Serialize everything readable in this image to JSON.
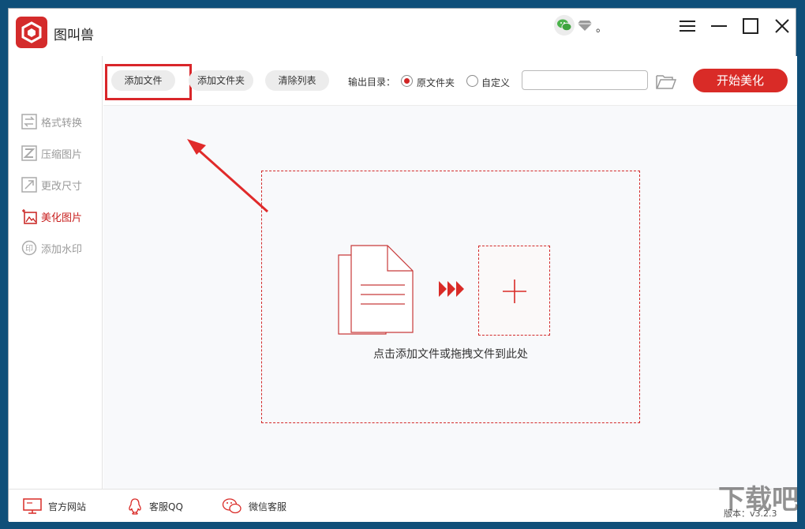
{
  "app": {
    "title": "图叫兽",
    "title_dot": "。"
  },
  "window_controls": [
    "menu-icon",
    "minimize-icon",
    "maximize-icon",
    "close-icon"
  ],
  "sidebar": {
    "items": [
      {
        "label": "格式转换",
        "icon": "format-convert-icon",
        "active": false
      },
      {
        "label": "压缩图片",
        "icon": "compress-icon",
        "active": false
      },
      {
        "label": "更改尺寸",
        "icon": "resize-icon",
        "active": false
      },
      {
        "label": "美化图片",
        "icon": "beautify-icon",
        "active": true
      },
      {
        "label": "添加水印",
        "icon": "watermark-icon",
        "active": false
      }
    ]
  },
  "toolbar": {
    "add_file_label": "添加文件",
    "add_folder_label": "添加文件夹",
    "clear_list_label": "清除列表",
    "output_label": "输出目录：",
    "option_original": "原文件夹",
    "option_custom": "自定义",
    "path_value": "",
    "start_label": "开始美化"
  },
  "content": {
    "drop_text": "点击添加文件或拖拽文件到此处"
  },
  "statusbar": {
    "website_label": "官方网站",
    "qq_label": "客服QQ",
    "wechat_label": "微信客服",
    "version_label": "版本：v3.2.3"
  },
  "colors": {
    "accent": "#d92b27",
    "sidebar_inactive": "#9a9a9a",
    "background": "#f8f9fb"
  }
}
